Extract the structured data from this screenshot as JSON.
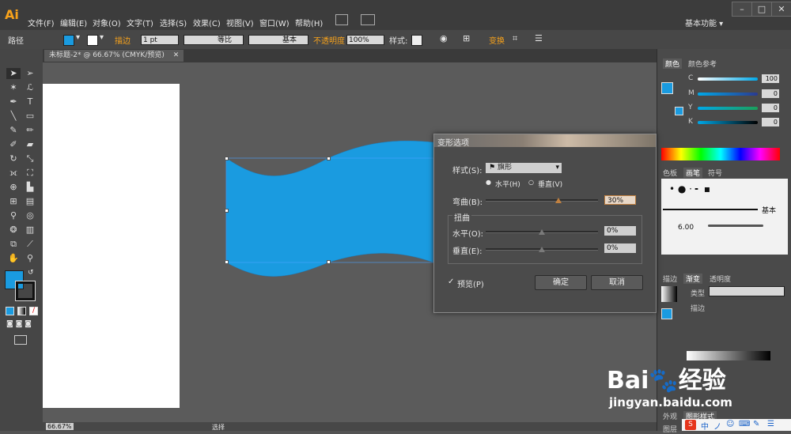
{
  "app": {
    "logo": "Ai",
    "workspace": "基本功能 ▾"
  },
  "menu": [
    "文件(F)",
    "编辑(E)",
    "对象(O)",
    "文字(T)",
    "选择(S)",
    "效果(C)",
    "视图(V)",
    "窗口(W)",
    "帮助(H)"
  ],
  "control_bar": {
    "object_type": "路径",
    "stroke_label": "描边",
    "stroke_weight": "1 pt",
    "stroke_profile": "等比",
    "brush": "基本",
    "opacity_label": "不透明度",
    "opacity_value": "100%",
    "style_label": "样式:",
    "transform_label": "变换",
    "fill_color": "#1a9be0"
  },
  "document": {
    "tab_title": "未标题-2* @ 66.67% (CMYK/预览)",
    "status_zoom": "66.67%",
    "status_tool": "选择"
  },
  "panels": {
    "color_tabs": [
      "颜色",
      "颜色参考"
    ],
    "cmyk": [
      {
        "channel": "C",
        "value": "100",
        "level": 1.0,
        "gradient": "linear-gradient(90deg,#fff,#00a8e8)"
      },
      {
        "channel": "M",
        "value": "0",
        "level": 0.0,
        "gradient": "linear-gradient(90deg,#00a8e8,#2b3a8f)"
      },
      {
        "channel": "Y",
        "value": "0",
        "level": 0.0,
        "gradient": "linear-gradient(90deg,#00a8e8,#1aa05a)"
      },
      {
        "channel": "K",
        "value": "0",
        "level": 0.0,
        "gradient": "linear-gradient(90deg,#00a8e8,#000)"
      }
    ],
    "brush_tabs": [
      "色板",
      "画笔",
      "符号"
    ],
    "brush_basic": "基本",
    "brush_size": "6.00",
    "gradient_tabs": [
      "描边",
      "渐变",
      "透明度"
    ],
    "gradient_type_label": "类型",
    "gradient_stroke_label": "描边",
    "bottom_tabs": [
      "外观",
      "图形样式"
    ],
    "layers_tab": "图层"
  },
  "dialog": {
    "title": "变形选项",
    "style_label": "样式(S):",
    "style_value": "旗形",
    "horizontal_label": "水平(H)",
    "vertical_label": "垂直(V)",
    "orientation": "horizontal",
    "bend_label": "弯曲(B):",
    "bend_value": "30%",
    "bend_level": 0.65,
    "distortion_label": "扭曲",
    "dist_h_label": "水平(O):",
    "dist_h_value": "0%",
    "dist_h_level": 0.5,
    "dist_v_label": "垂直(E):",
    "dist_v_value": "0%",
    "dist_v_level": 0.5,
    "preview_label": "预览(P)",
    "preview_checked": true,
    "ok_label": "确定",
    "cancel_label": "取消"
  },
  "watermark": {
    "brand_a": "Bai",
    "brand_b": "经验",
    "url": "jingyan.baidu.com"
  },
  "taskbar": [
    "中",
    "ノ",
    "☺",
    "⌨",
    "✎",
    "☰"
  ]
}
